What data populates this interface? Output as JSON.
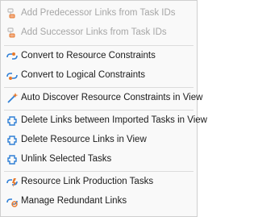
{
  "menu": {
    "items": [
      {
        "label": "Add Predecessor Links from Task IDs",
        "enabled": false,
        "icon": "add-predecessor-links-icon"
      },
      {
        "label": "Add Successor Links from Task IDs",
        "enabled": false,
        "icon": "add-successor-links-icon"
      },
      {
        "label": "Convert to Resource Constraints",
        "enabled": true,
        "icon": "convert-resource-icon"
      },
      {
        "label": "Convert to Logical Constraints",
        "enabled": true,
        "icon": "convert-logical-icon"
      },
      {
        "label": "Auto Discover Resource Constraints in View",
        "enabled": true,
        "icon": "auto-discover-icon"
      },
      {
        "label": "Delete Links between Imported Tasks in View",
        "enabled": true,
        "icon": "delete-links-icon"
      },
      {
        "label": "Delete Resource Links in View",
        "enabled": true,
        "icon": "delete-resource-links-icon"
      },
      {
        "label": "Unlink Selected Tasks",
        "enabled": true,
        "icon": "unlink-icon"
      },
      {
        "label": "Resource Link Production Tasks",
        "enabled": true,
        "icon": "resource-link-production-icon"
      },
      {
        "label": "Manage Redundant Links",
        "enabled": true,
        "icon": "manage-redundant-links-icon"
      }
    ]
  },
  "colors": {
    "link_blue": "#2f7fd6",
    "link_orange": "#e8792b",
    "disabled_text": "#a6a6a6"
  }
}
